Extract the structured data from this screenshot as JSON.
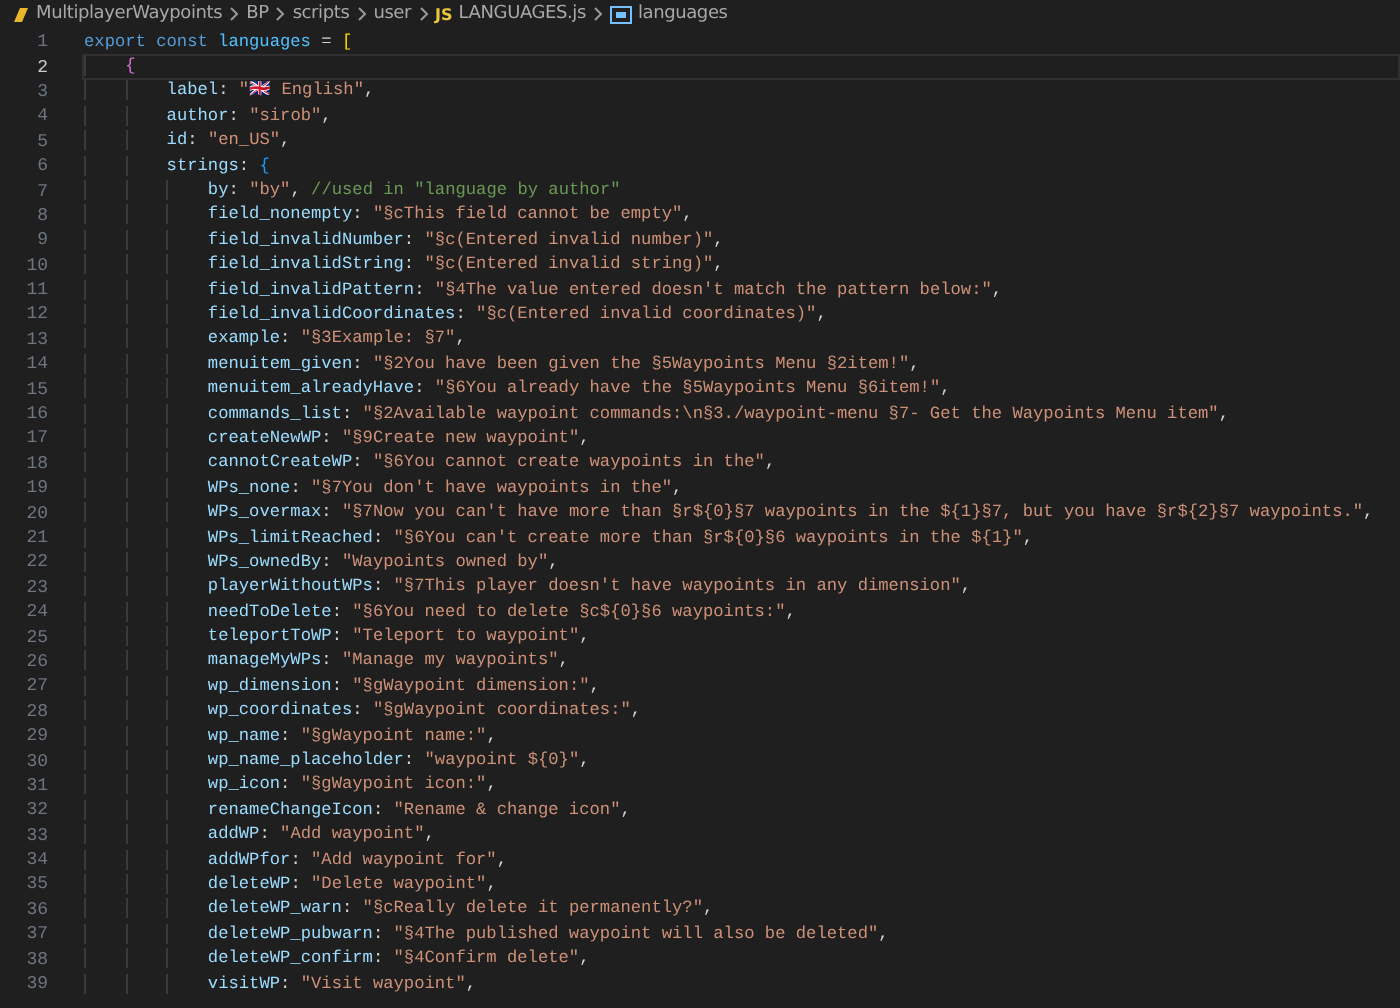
{
  "breadcrumb": [
    {
      "kind": "folder",
      "text": "MultiplayerWaypoints"
    },
    {
      "kind": "folder",
      "text": "BP"
    },
    {
      "kind": "folder",
      "text": "scripts"
    },
    {
      "kind": "folder",
      "text": "user"
    },
    {
      "kind": "file",
      "badge": "JS",
      "text": "LANGUAGES.js"
    },
    {
      "kind": "symbol",
      "text": "languages"
    }
  ],
  "lines": [
    {
      "number": "1",
      "current": false,
      "tokens": [
        {
          "kind": "keyword",
          "text": "export const "
        },
        {
          "kind": "variable",
          "text": "languages"
        },
        {
          "kind": "punct",
          "text": " = "
        },
        {
          "kind": "bracket1",
          "text": "["
        }
      ]
    },
    {
      "number": "2",
      "current": true,
      "tokens": [
        {
          "kind": "bracket2",
          "text": "    {"
        }
      ]
    },
    {
      "number": "3",
      "current": false,
      "tokens": [
        {
          "kind": "key",
          "text": "        label"
        },
        {
          "kind": "punct",
          "text": ": "
        },
        {
          "kind": "string",
          "text": "\"🇬🇧 English\""
        },
        {
          "kind": "punct",
          "text": ","
        }
      ]
    },
    {
      "number": "4",
      "current": false,
      "tokens": [
        {
          "kind": "key",
          "text": "        author"
        },
        {
          "kind": "punct",
          "text": ": "
        },
        {
          "kind": "string",
          "text": "\"sirob\""
        },
        {
          "kind": "punct",
          "text": ","
        }
      ]
    },
    {
      "number": "5",
      "current": false,
      "tokens": [
        {
          "kind": "key",
          "text": "        id"
        },
        {
          "kind": "punct",
          "text": ": "
        },
        {
          "kind": "string",
          "text": "\"en_US\""
        },
        {
          "kind": "punct",
          "text": ","
        }
      ]
    },
    {
      "number": "6",
      "current": false,
      "tokens": [
        {
          "kind": "key",
          "text": "        strings"
        },
        {
          "kind": "punct",
          "text": ": "
        },
        {
          "kind": "bracket3",
          "text": "{"
        }
      ]
    },
    {
      "number": "7",
      "current": false,
      "tokens": [
        {
          "kind": "key",
          "text": "            by"
        },
        {
          "kind": "punct",
          "text": ": "
        },
        {
          "kind": "string",
          "text": "\"by\""
        },
        {
          "kind": "punct",
          "text": ", "
        },
        {
          "kind": "comment",
          "text": "//used in \"language by author\""
        }
      ]
    },
    {
      "number": "8",
      "current": false,
      "tokens": [
        {
          "kind": "key",
          "text": "            field_nonempty"
        },
        {
          "kind": "punct",
          "text": ": "
        },
        {
          "kind": "string",
          "text": "\"§cThis field cannot be empty\""
        },
        {
          "kind": "punct",
          "text": ","
        }
      ]
    },
    {
      "number": "9",
      "current": false,
      "tokens": [
        {
          "kind": "key",
          "text": "            field_invalidNumber"
        },
        {
          "kind": "punct",
          "text": ": "
        },
        {
          "kind": "string",
          "text": "\"§c(Entered invalid number)\""
        },
        {
          "kind": "punct",
          "text": ","
        }
      ]
    },
    {
      "number": "10",
      "current": false,
      "tokens": [
        {
          "kind": "key",
          "text": "            field_invalidString"
        },
        {
          "kind": "punct",
          "text": ": "
        },
        {
          "kind": "string",
          "text": "\"§c(Entered invalid string)\""
        },
        {
          "kind": "punct",
          "text": ","
        }
      ]
    },
    {
      "number": "11",
      "current": false,
      "tokens": [
        {
          "kind": "key",
          "text": "            field_invalidPattern"
        },
        {
          "kind": "punct",
          "text": ": "
        },
        {
          "kind": "string",
          "text": "\"§4The value entered doesn't match the pattern below:\""
        },
        {
          "kind": "punct",
          "text": ","
        }
      ]
    },
    {
      "number": "12",
      "current": false,
      "tokens": [
        {
          "kind": "key",
          "text": "            field_invalidCoordinates"
        },
        {
          "kind": "punct",
          "text": ": "
        },
        {
          "kind": "string",
          "text": "\"§c(Entered invalid coordinates)\""
        },
        {
          "kind": "punct",
          "text": ","
        }
      ]
    },
    {
      "number": "13",
      "current": false,
      "tokens": [
        {
          "kind": "key",
          "text": "            example"
        },
        {
          "kind": "punct",
          "text": ": "
        },
        {
          "kind": "string",
          "text": "\"§3Example: §7\""
        },
        {
          "kind": "punct",
          "text": ","
        }
      ]
    },
    {
      "number": "14",
      "current": false,
      "tokens": [
        {
          "kind": "key",
          "text": "            menuitem_given"
        },
        {
          "kind": "punct",
          "text": ": "
        },
        {
          "kind": "string",
          "text": "\"§2You have been given the §5Waypoints Menu §2item!\""
        },
        {
          "kind": "punct",
          "text": ","
        }
      ]
    },
    {
      "number": "15",
      "current": false,
      "tokens": [
        {
          "kind": "key",
          "text": "            menuitem_alreadyHave"
        },
        {
          "kind": "punct",
          "text": ": "
        },
        {
          "kind": "string",
          "text": "\"§6You already have the §5Waypoints Menu §6item!\""
        },
        {
          "kind": "punct",
          "text": ","
        }
      ]
    },
    {
      "number": "16",
      "current": false,
      "tokens": [
        {
          "kind": "key",
          "text": "            commands_list"
        },
        {
          "kind": "punct",
          "text": ": "
        },
        {
          "kind": "string",
          "text": "\"§2Available waypoint commands:\\n§3./waypoint-menu §7- Get the Waypoints Menu item\""
        },
        {
          "kind": "punct",
          "text": ","
        }
      ]
    },
    {
      "number": "17",
      "current": false,
      "tokens": [
        {
          "kind": "key",
          "text": "            createNewWP"
        },
        {
          "kind": "punct",
          "text": ": "
        },
        {
          "kind": "string",
          "text": "\"§9Create new waypoint\""
        },
        {
          "kind": "punct",
          "text": ","
        }
      ]
    },
    {
      "number": "18",
      "current": false,
      "tokens": [
        {
          "kind": "key",
          "text": "            cannotCreateWP"
        },
        {
          "kind": "punct",
          "text": ": "
        },
        {
          "kind": "string",
          "text": "\"§6You cannot create waypoints in the\""
        },
        {
          "kind": "punct",
          "text": ","
        }
      ]
    },
    {
      "number": "19",
      "current": false,
      "tokens": [
        {
          "kind": "key",
          "text": "            WPs_none"
        },
        {
          "kind": "punct",
          "text": ": "
        },
        {
          "kind": "string",
          "text": "\"§7You don't have waypoints in the\""
        },
        {
          "kind": "punct",
          "text": ","
        }
      ]
    },
    {
      "number": "20",
      "current": false,
      "tokens": [
        {
          "kind": "key",
          "text": "            WPs_overmax"
        },
        {
          "kind": "punct",
          "text": ": "
        },
        {
          "kind": "string",
          "text": "\"§7Now you can't have more than §r${0}§7 waypoints in the ${1}§7, but you have §r${2}§7 waypoints.\""
        },
        {
          "kind": "punct",
          "text": ","
        }
      ]
    },
    {
      "number": "21",
      "current": false,
      "tokens": [
        {
          "kind": "key",
          "text": "            WPs_limitReached"
        },
        {
          "kind": "punct",
          "text": ": "
        },
        {
          "kind": "string",
          "text": "\"§6You can't create more than §r${0}§6 waypoints in the ${1}\""
        },
        {
          "kind": "punct",
          "text": ","
        }
      ]
    },
    {
      "number": "22",
      "current": false,
      "tokens": [
        {
          "kind": "key",
          "text": "            WPs_ownedBy"
        },
        {
          "kind": "punct",
          "text": ": "
        },
        {
          "kind": "string",
          "text": "\"Waypoints owned by\""
        },
        {
          "kind": "punct",
          "text": ","
        }
      ]
    },
    {
      "number": "23",
      "current": false,
      "tokens": [
        {
          "kind": "key",
          "text": "            playerWithoutWPs"
        },
        {
          "kind": "punct",
          "text": ": "
        },
        {
          "kind": "string",
          "text": "\"§7This player doesn't have waypoints in any dimension\""
        },
        {
          "kind": "punct",
          "text": ","
        }
      ]
    },
    {
      "number": "24",
      "current": false,
      "tokens": [
        {
          "kind": "key",
          "text": "            needToDelete"
        },
        {
          "kind": "punct",
          "text": ": "
        },
        {
          "kind": "string",
          "text": "\"§6You need to delete §c${0}§6 waypoints:\""
        },
        {
          "kind": "punct",
          "text": ","
        }
      ]
    },
    {
      "number": "25",
      "current": false,
      "tokens": [
        {
          "kind": "key",
          "text": "            teleportToWP"
        },
        {
          "kind": "punct",
          "text": ": "
        },
        {
          "kind": "string",
          "text": "\"Teleport to waypoint\""
        },
        {
          "kind": "punct",
          "text": ","
        }
      ]
    },
    {
      "number": "26",
      "current": false,
      "tokens": [
        {
          "kind": "key",
          "text": "            manageMyWPs"
        },
        {
          "kind": "punct",
          "text": ": "
        },
        {
          "kind": "string",
          "text": "\"Manage my waypoints\""
        },
        {
          "kind": "punct",
          "text": ","
        }
      ]
    },
    {
      "number": "27",
      "current": false,
      "tokens": [
        {
          "kind": "key",
          "text": "            wp_dimension"
        },
        {
          "kind": "punct",
          "text": ": "
        },
        {
          "kind": "string",
          "text": "\"§gWaypoint dimension:\""
        },
        {
          "kind": "punct",
          "text": ","
        }
      ]
    },
    {
      "number": "28",
      "current": false,
      "tokens": [
        {
          "kind": "key",
          "text": "            wp_coordinates"
        },
        {
          "kind": "punct",
          "text": ": "
        },
        {
          "kind": "string",
          "text": "\"§gWaypoint coordinates:\""
        },
        {
          "kind": "punct",
          "text": ","
        }
      ]
    },
    {
      "number": "29",
      "current": false,
      "tokens": [
        {
          "kind": "key",
          "text": "            wp_name"
        },
        {
          "kind": "punct",
          "text": ": "
        },
        {
          "kind": "string",
          "text": "\"§gWaypoint name:\""
        },
        {
          "kind": "punct",
          "text": ","
        }
      ]
    },
    {
      "number": "30",
      "current": false,
      "tokens": [
        {
          "kind": "key",
          "text": "            wp_name_placeholder"
        },
        {
          "kind": "punct",
          "text": ": "
        },
        {
          "kind": "string",
          "text": "\"waypoint ${0}\""
        },
        {
          "kind": "punct",
          "text": ","
        }
      ]
    },
    {
      "number": "31",
      "current": false,
      "tokens": [
        {
          "kind": "key",
          "text": "            wp_icon"
        },
        {
          "kind": "punct",
          "text": ": "
        },
        {
          "kind": "string",
          "text": "\"§gWaypoint icon:\""
        },
        {
          "kind": "punct",
          "text": ","
        }
      ]
    },
    {
      "number": "32",
      "current": false,
      "tokens": [
        {
          "kind": "key",
          "text": "            renameChangeIcon"
        },
        {
          "kind": "punct",
          "text": ": "
        },
        {
          "kind": "string",
          "text": "\"Rename & change icon\""
        },
        {
          "kind": "punct",
          "text": ","
        }
      ]
    },
    {
      "number": "33",
      "current": false,
      "tokens": [
        {
          "kind": "key",
          "text": "            addWP"
        },
        {
          "kind": "punct",
          "text": ": "
        },
        {
          "kind": "string",
          "text": "\"Add waypoint\""
        },
        {
          "kind": "punct",
          "text": ","
        }
      ]
    },
    {
      "number": "34",
      "current": false,
      "tokens": [
        {
          "kind": "key",
          "text": "            addWPfor"
        },
        {
          "kind": "punct",
          "text": ": "
        },
        {
          "kind": "string",
          "text": "\"Add waypoint for\""
        },
        {
          "kind": "punct",
          "text": ","
        }
      ]
    },
    {
      "number": "35",
      "current": false,
      "tokens": [
        {
          "kind": "key",
          "text": "            deleteWP"
        },
        {
          "kind": "punct",
          "text": ": "
        },
        {
          "kind": "string",
          "text": "\"Delete waypoint\""
        },
        {
          "kind": "punct",
          "text": ","
        }
      ]
    },
    {
      "number": "36",
      "current": false,
      "tokens": [
        {
          "kind": "key",
          "text": "            deleteWP_warn"
        },
        {
          "kind": "punct",
          "text": ": "
        },
        {
          "kind": "string",
          "text": "\"§cReally delete it permanently?\""
        },
        {
          "kind": "punct",
          "text": ","
        }
      ]
    },
    {
      "number": "37",
      "current": false,
      "tokens": [
        {
          "kind": "key",
          "text": "            deleteWP_pubwarn"
        },
        {
          "kind": "punct",
          "text": ": "
        },
        {
          "kind": "string",
          "text": "\"§4The published waypoint will also be deleted\""
        },
        {
          "kind": "punct",
          "text": ","
        }
      ]
    },
    {
      "number": "38",
      "current": false,
      "tokens": [
        {
          "kind": "key",
          "text": "            deleteWP_confirm"
        },
        {
          "kind": "punct",
          "text": ": "
        },
        {
          "kind": "string",
          "text": "\"§4Confirm delete\""
        },
        {
          "kind": "punct",
          "text": ","
        }
      ]
    },
    {
      "number": "39",
      "current": false,
      "tokens": [
        {
          "kind": "key",
          "text": "            visitWP"
        },
        {
          "kind": "punct",
          "text": ": "
        },
        {
          "kind": "string",
          "text": "\"Visit waypoint\""
        },
        {
          "kind": "punct",
          "text": ","
        }
      ]
    }
  ]
}
